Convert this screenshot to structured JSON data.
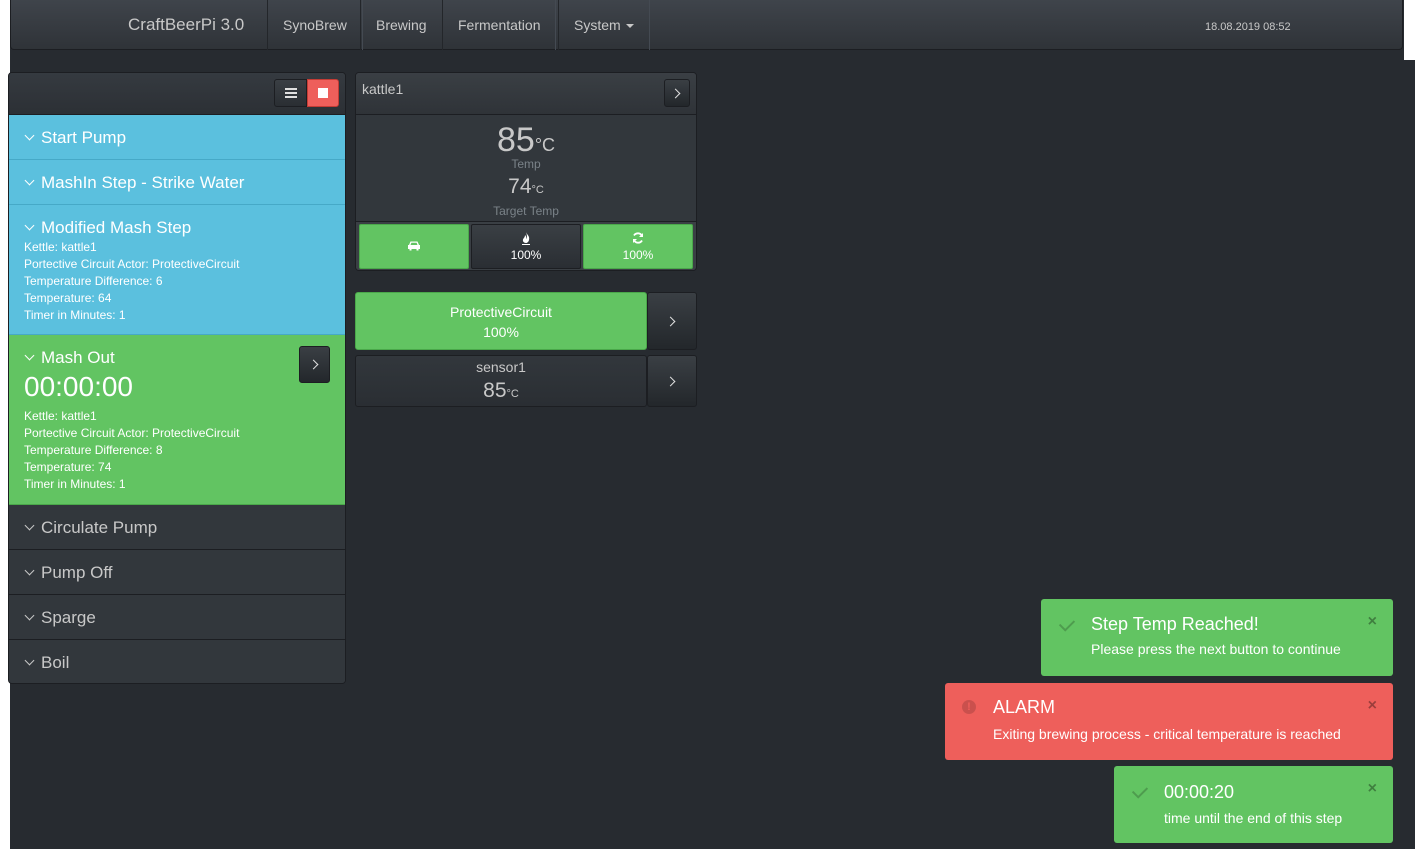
{
  "nav": {
    "brand": "CraftBeerPi 3.0",
    "items": [
      "SynoBrew",
      "Brewing",
      "Fermentation",
      "System"
    ],
    "datetime": "18.08.2019 08:52"
  },
  "steps": [
    {
      "title": "Start Pump",
      "state": "done",
      "details": []
    },
    {
      "title": "MashIn Step - Strike Water",
      "state": "done",
      "details": []
    },
    {
      "title": "Modified Mash Step",
      "state": "done",
      "details": [
        "Kettle: kattle1",
        "Portective Circuit Actor: ProtectiveCircuit",
        "Temperature Difference: 6",
        "Temperature: 64",
        "Timer in Minutes: 1"
      ]
    },
    {
      "title": "Mash Out",
      "state": "active",
      "timer": "00:00:00",
      "details": [
        "Kettle: kattle1",
        "Portective Circuit Actor: ProtectiveCircuit",
        "Temperature Difference: 8",
        "Temperature: 74",
        "Timer in Minutes: 1"
      ]
    },
    {
      "title": "Circulate Pump",
      "state": "pending",
      "details": []
    },
    {
      "title": "Pump Off",
      "state": "pending",
      "details": []
    },
    {
      "title": "Sparge",
      "state": "pending",
      "details": []
    },
    {
      "title": "Boil",
      "state": "pending",
      "details": []
    }
  ],
  "kettle": {
    "name": "kattle1",
    "temp": "85",
    "temp_unit": "°C",
    "temp_label": "Temp",
    "target": "74",
    "target_unit": "°C",
    "target_label": "Target Temp",
    "actors": [
      {
        "icon": "car-icon",
        "value": "",
        "on": true
      },
      {
        "icon": "fire-icon",
        "value": "100%",
        "on": false
      },
      {
        "icon": "refresh-icon",
        "value": "100%",
        "on": true
      }
    ]
  },
  "protective": {
    "name": "ProtectiveCircuit",
    "value": "100%"
  },
  "sensor": {
    "name": "sensor1",
    "value": "85",
    "unit": "°C"
  },
  "notifications": [
    {
      "type": "success",
      "title": "Step Temp Reached!",
      "message": "Please press the next button to continue"
    },
    {
      "type": "danger",
      "title": "ALARM",
      "message": "Exiting brewing process - critical temperature is reached"
    },
    {
      "type": "success",
      "title": "00:00:20",
      "message": "time until the end of this step"
    }
  ],
  "close_glyph": "×",
  "colors": {
    "success": "#62c462",
    "danger": "#ee5f5b",
    "info": "#5bc0de",
    "background": "#272b30"
  }
}
